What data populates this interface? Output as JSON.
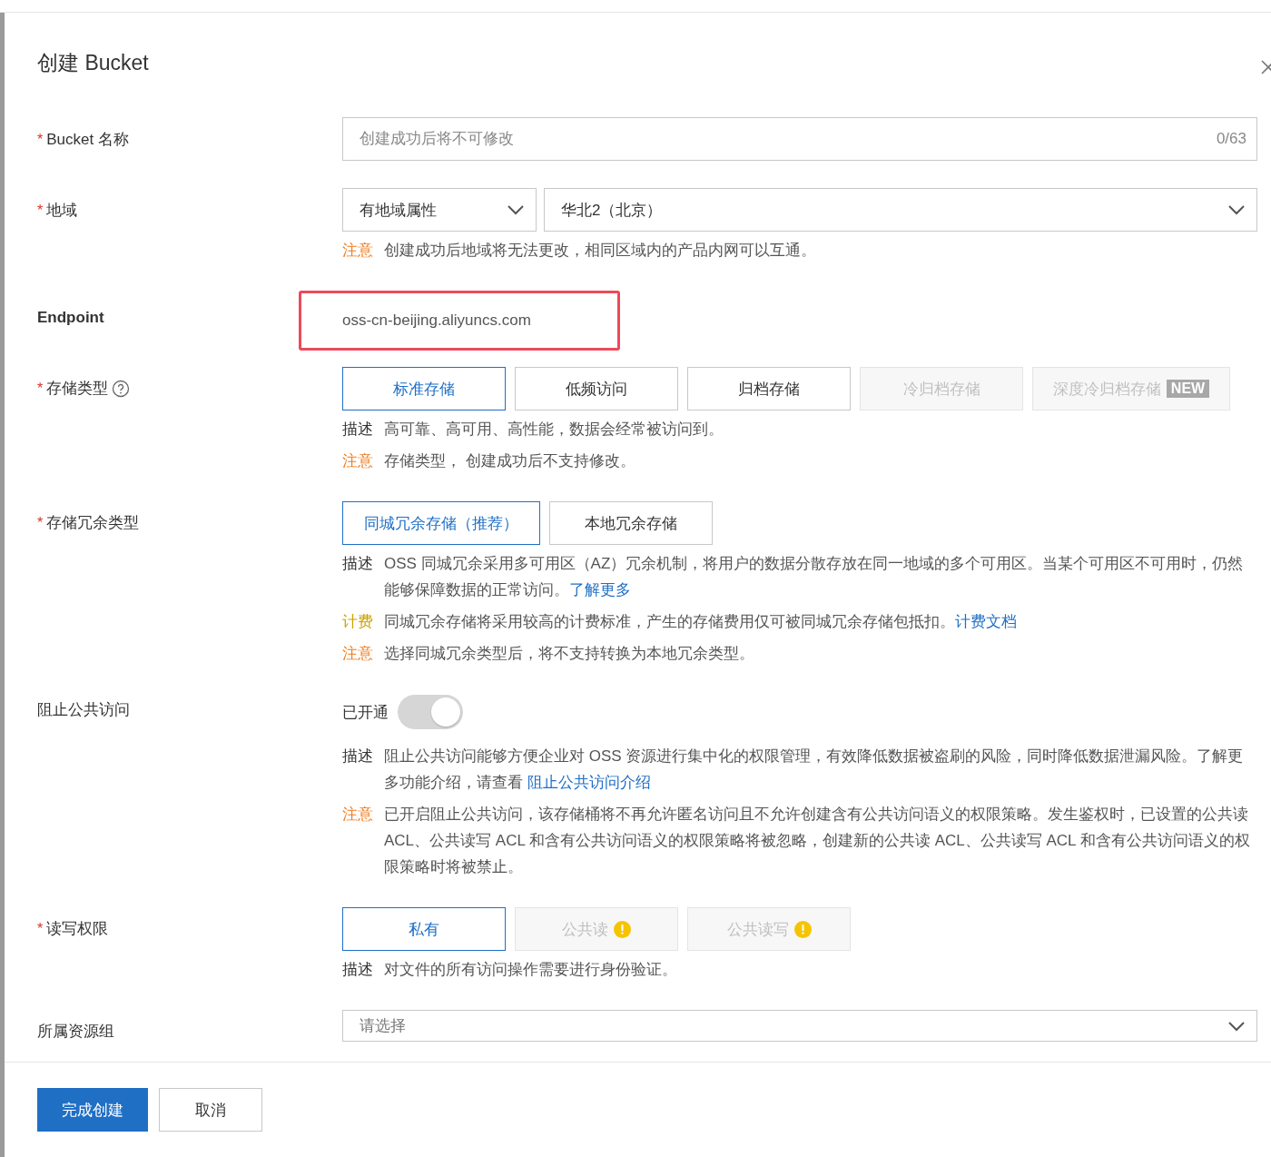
{
  "dialog": {
    "title": "创建 Bucket"
  },
  "fields": [
    {
      "kind": "text",
      "label": "Bucket 名称",
      "required": "*",
      "placeholder": "创建成功后将不可修改",
      "counter": "0/63"
    },
    {
      "kind": "selects",
      "label": "地域",
      "required": "*",
      "selects": [
        {
          "value": "有地域属性"
        },
        {
          "value": "华北2（北京）"
        }
      ],
      "notes": [
        {
          "kind": "note",
          "label": "注意",
          "text": "创建成功后地域将无法更改，相同区域内的产品内网可以互通。"
        }
      ]
    },
    {
      "kind": "static",
      "label": "Endpoint",
      "value": "oss-cn-beijing.aliyuncs.com",
      "highlighted": true
    },
    {
      "kind": "options",
      "label": "存储类型",
      "required": "*",
      "help": true,
      "options": [
        {
          "label": "标准存储",
          "selected": true,
          "disabled": false
        },
        {
          "label": "低频访问",
          "selected": false,
          "disabled": false
        },
        {
          "label": "归档存储",
          "selected": false,
          "disabled": false
        },
        {
          "label": "冷归档存储",
          "selected": false,
          "disabled": true
        },
        {
          "label": "深度冷归档存储",
          "badge": "NEW",
          "selected": false,
          "disabled": true
        }
      ],
      "notes": [
        {
          "kind": "desc",
          "label": "描述",
          "text": "高可靠、高可用、高性能，数据会经常被访问到。"
        },
        {
          "kind": "note",
          "label": "注意",
          "text": "存储类型， 创建成功后不支持修改。"
        }
      ]
    },
    {
      "kind": "options",
      "label": "存储冗余类型",
      "required": "*",
      "options": [
        {
          "label": "同城冗余存储（推荐）",
          "selected": true,
          "disabled": false
        },
        {
          "label": "本地冗余存储",
          "selected": false,
          "disabled": false
        }
      ],
      "notes": [
        {
          "kind": "desc",
          "label": "描述",
          "text": "OSS 同城冗余采用多可用区（AZ）冗余机制，将用户的数据分散存放在同一地域的多个可用区。当某个可用区不可用时，仍然能够保障数据的正常访问。",
          "link": "了解更多"
        },
        {
          "kind": "billing",
          "label": "计费",
          "text": "同城冗余存储将采用较高的计费标准，产生的存储费用仅可被同城冗余存储包抵扣。",
          "link": "计费文档"
        },
        {
          "kind": "note",
          "label": "注意",
          "text": "选择同城冗余类型后，将不支持转换为本地冗余类型。"
        }
      ]
    },
    {
      "kind": "switch",
      "label": "阻止公共访问",
      "state": "已开通",
      "on": true,
      "disabled": true,
      "notes": [
        {
          "kind": "desc",
          "label": "描述",
          "text": "阻止公共访问能够方便企业对 OSS 资源进行集中化的权限管理，有效降低数据被盗刷的风险，同时降低数据泄漏风险。了解更多功能介绍，请查看 ",
          "link": "阻止公共访问介绍"
        },
        {
          "kind": "note",
          "label": "注意",
          "text": "已开启阻止公共访问，该存储桶将不再允许匿名访问且不允许创建含有公共访问语义的权限策略。发生鉴权时，已设置的公共读 ACL、公共读写 ACL 和含有公共访问语义的权限策略将被忽略，创建新的公共读 ACL、公共读写 ACL 和含有公共访问语义的权限策略时将被禁止。"
        }
      ]
    },
    {
      "kind": "options",
      "label": "读写权限",
      "required": "*",
      "options": [
        {
          "label": "私有",
          "selected": true,
          "disabled": false,
          "warning": false
        },
        {
          "label": "公共读",
          "selected": false,
          "disabled": true,
          "warning": true
        },
        {
          "label": "公共读写",
          "selected": false,
          "disabled": true,
          "warning": true
        }
      ],
      "notes": [
        {
          "kind": "desc",
          "label": "描述",
          "text": "对文件的所有访问操作需要进行身份验证。"
        }
      ]
    },
    {
      "kind": "select",
      "label": "所属资源组",
      "placeholder": "请选择"
    }
  ],
  "footer": {
    "buttons": [
      {
        "label": "完成创建",
        "kind": "primary"
      },
      {
        "label": "取消",
        "kind": "default"
      }
    ]
  }
}
